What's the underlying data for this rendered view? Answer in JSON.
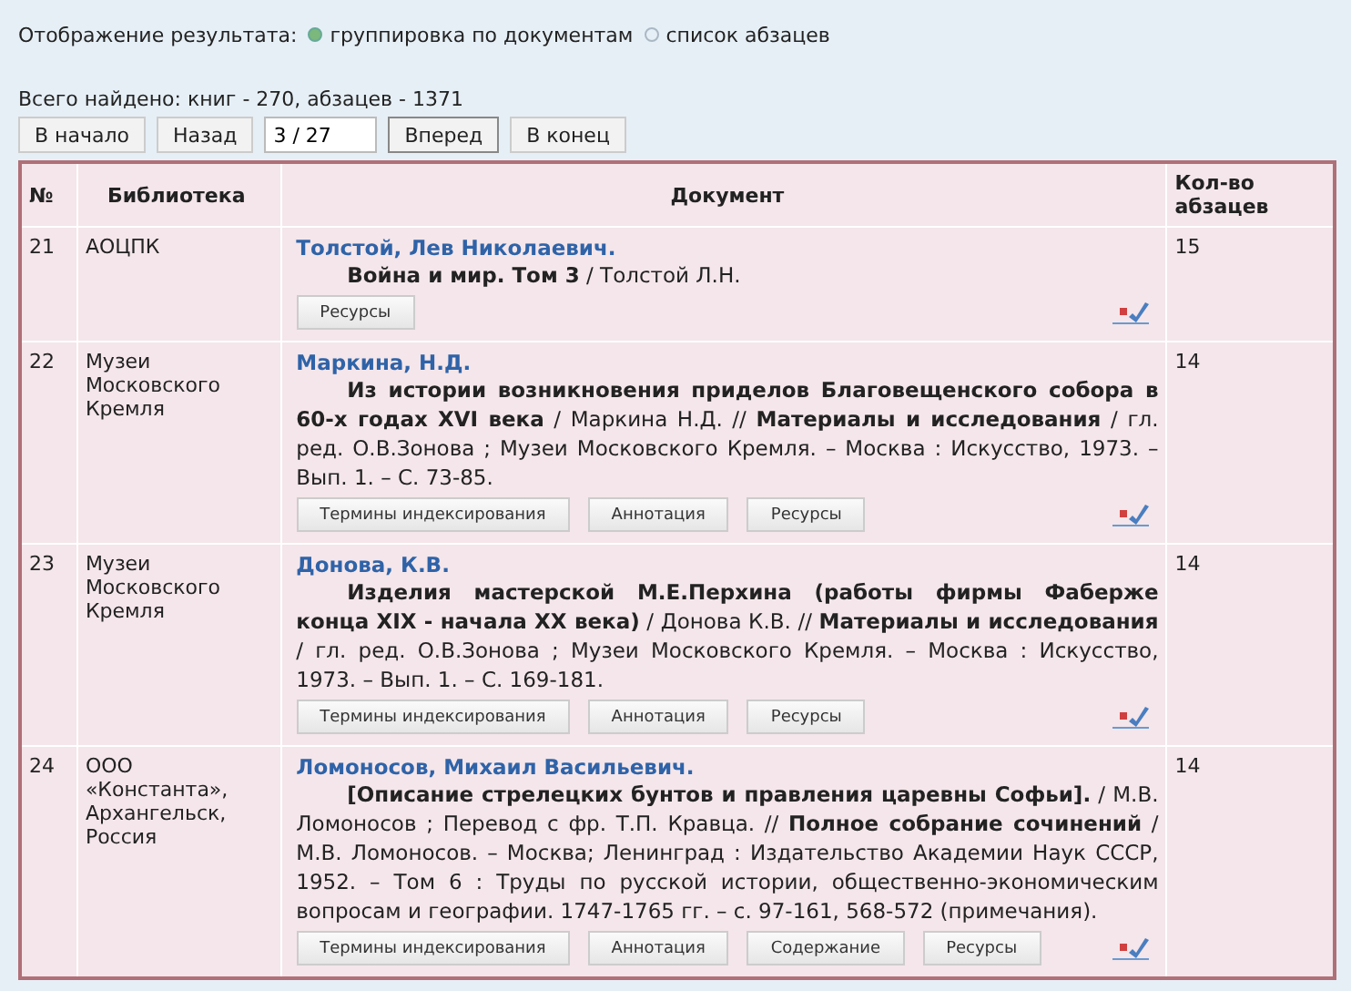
{
  "display_mode": {
    "label": "Отображение результата:",
    "options": [
      {
        "label": "группировка по документам",
        "selected": true
      },
      {
        "label": "список абзацев",
        "selected": false
      }
    ]
  },
  "summary": "Всего найдено: книг - 270,  абзацев - 1371",
  "pagination": {
    "buttons": [
      "В начало",
      "Назад"
    ],
    "page": "3 / 27",
    "next_buttons": [
      "Вперед",
      "В конец"
    ]
  },
  "table": {
    "columns": [
      "№",
      "Библиотека",
      "Документ",
      "Кол-во абзацев"
    ],
    "rows": [
      {
        "number": "21",
        "library": "АОЦПК",
        "author": "Толстой, Лев Николаевич.",
        "description": "**Война и мир. Том 3** / Толстой Л.Н.",
        "buttons": [
          "Ресурсы"
        ],
        "count": "15"
      },
      {
        "number": "22",
        "library": "Музеи Московского Кремля",
        "author": "Маркина, Н.Д.",
        "description": "**Из истории возникновения приделов Благовещенского собора в 60-х годах XVI века** / Маркина Н.Д. // **Материалы и исследования** / гл. ред. О.В.Зонова ; Музеи Московского Кремля. – Москва : Искусство, 1973. – Вып. 1. – С. 73-85.",
        "buttons": [
          "Термины индексирования",
          "Аннотация",
          "Ресурсы"
        ],
        "count": "14"
      },
      {
        "number": "23",
        "library": "Музеи Московского Кремля",
        "author": "Донова, К.В.",
        "description": "**Изделия мастерской М.Е.Перхина (работы фирмы Фаберже конца XIX - начала XX века)** / Донова К.В. // **Материалы и исследования** / гл. ред. О.В.Зонова ; Музеи Московского Кремля. – Москва : Искусство, 1973. – Вып. 1. – С. 169-181.",
        "buttons": [
          "Термины индексирования",
          "Аннотация",
          "Ресурсы"
        ],
        "count": "14"
      },
      {
        "number": "24",
        "library": "ООО «Константа», Архангельск, Россия",
        "author": "Ломоносов, Михаил Васильевич.",
        "description": "**[Описание стрелецких бунтов и правления царевны Софьи].** / М.В. Ломоносов ; Перевод с фр. Т.П. Кравца. // **Полное собрание сочинений** / М.В. Ломоносов. – Москва; Ленинград : Издательство Академии Наук СССР, 1952. – Том 6 : Труды по русской истории, общественно-экономическим вопросам и географии. 1747-1765 гг. – с. 97-161, 568-572 (примечания).",
        "buttons": [
          "Термины индексирования",
          "Аннотация",
          "Содержание",
          "Ресурсы"
        ],
        "count": "14"
      }
    ]
  }
}
